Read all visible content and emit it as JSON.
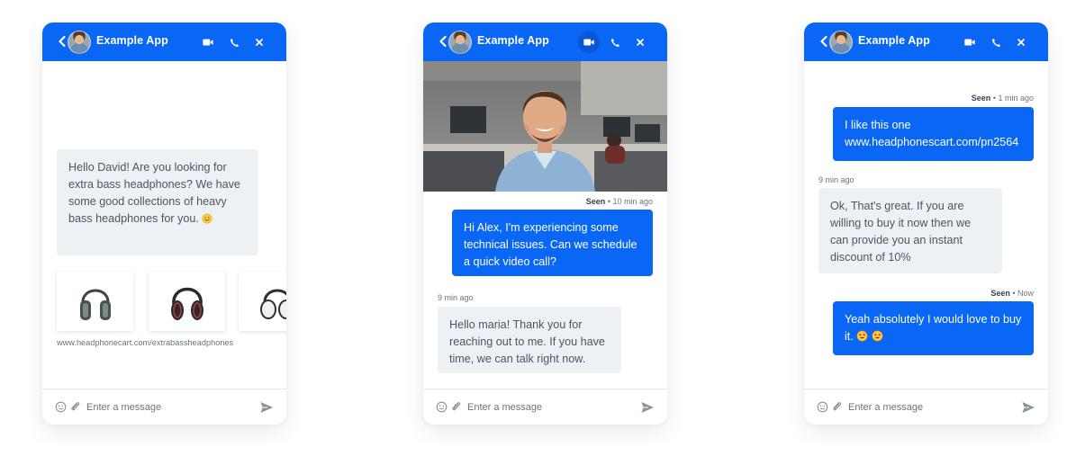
{
  "colors": {
    "accent": "#0a66f5",
    "incoming_bg": "#eef1f4",
    "text": "#4b5563"
  },
  "widgets": [
    {
      "header": {
        "title": "Example App"
      },
      "messages": [
        {
          "text": "Hello David! Are you looking for extra bass headphones? We have some good collections of heavy bass headphones for you.",
          "emoji": "smiling-face"
        }
      ],
      "products": [
        {
          "icon": "headphones-dark"
        },
        {
          "icon": "headphones-red"
        },
        {
          "icon": "headphones-white"
        }
      ],
      "product_link": "www.headphonecart.com/extrabassheadphones",
      "composer": {
        "placeholder": "Enter a message"
      }
    },
    {
      "header": {
        "title": "Example App",
        "active_button": "video"
      },
      "media": {
        "description": "video call preview"
      },
      "messages": [
        {
          "meta_status": "Seen",
          "meta_time": "10 min ago",
          "text": "Hi Alex, I'm experiencing some technical issues. Can we schedule a quick video call?"
        },
        {
          "meta_time": "9 min ago",
          "text": "Hello maria! Thank you for reaching out to me. If you have time, we can talk right now."
        }
      ],
      "composer": {
        "placeholder": "Enter a message"
      }
    },
    {
      "header": {
        "title": "Example App"
      },
      "messages": [
        {
          "meta_status": "Seen",
          "meta_time": "1 min ago",
          "text": "I like this one www.headphonescart.com/pn2564"
        },
        {
          "meta_time": "9 min ago",
          "text": "Ok, That's great. If you are willing to buy it now then we can provide you an instant discount of 10%"
        },
        {
          "meta_status": "Seen",
          "meta_time": "Now",
          "text": "Yeah absolutely I would love to buy it.",
          "emoji": "star-struck"
        }
      ],
      "composer": {
        "placeholder": "Enter a message"
      }
    }
  ]
}
